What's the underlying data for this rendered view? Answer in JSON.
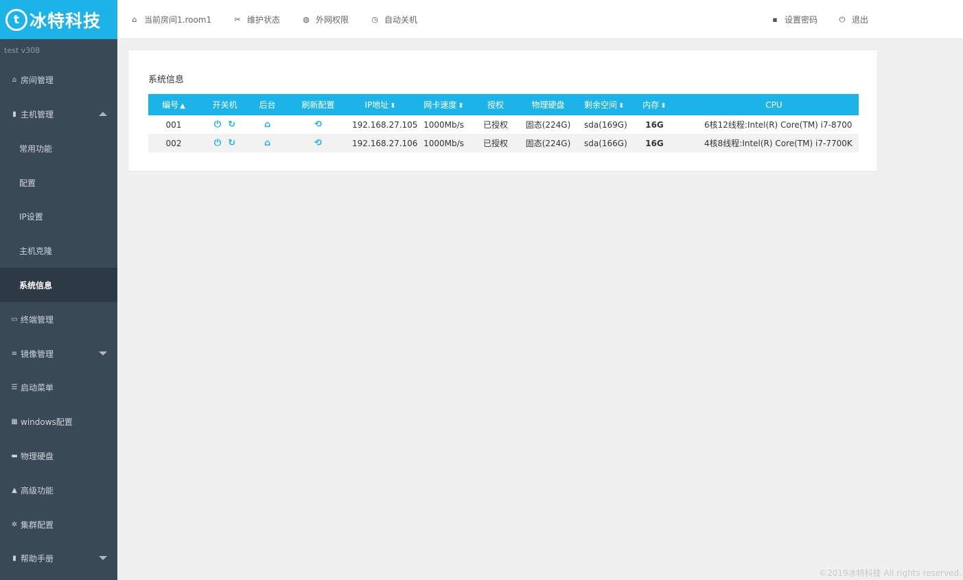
{
  "brand": {
    "badge": "t",
    "name": "冰特科技"
  },
  "topnav": {
    "room": "当前房间1.room1",
    "maintenance": "维护状态",
    "network": "外网权限",
    "auto_shutdown": "自动关机",
    "set_password": "设置密码",
    "logout": "退出"
  },
  "sidebar": {
    "version": "test  v308",
    "items": [
      {
        "label": "房间管理",
        "icon": "home-icon"
      },
      {
        "label": "主机管理",
        "icon": "server-icon"
      },
      {
        "label": "常用功能"
      },
      {
        "label": "配置"
      },
      {
        "label": "IP设置"
      },
      {
        "label": "主机克隆"
      },
      {
        "label": "系统信息"
      },
      {
        "label": "终端管理",
        "icon": "monitor-icon"
      },
      {
        "label": "镜像管理",
        "icon": "database-icon"
      },
      {
        "label": "启动菜单",
        "icon": "list-icon"
      },
      {
        "label": "windows配置",
        "icon": "windows-icon"
      },
      {
        "label": "物理硬盘",
        "icon": "hdd-icon"
      },
      {
        "label": "高级功能",
        "icon": "warning-icon"
      },
      {
        "label": "集群配置",
        "icon": "gear-icon"
      },
      {
        "label": "帮助手册",
        "icon": "book-icon"
      }
    ]
  },
  "panel": {
    "title": "系统信息",
    "columns": {
      "id": "编号",
      "power": "开关机",
      "backend": "后台",
      "refresh": "刷新配置",
      "ip": "IP地址",
      "nic": "网卡速度",
      "license": "授权",
      "disk": "物理硬盘",
      "free": "剩余空间",
      "memory": "内存",
      "cpu": "CPU"
    },
    "rows": [
      {
        "id": "001",
        "ip": "192.168.27.105",
        "nic": "1000Mb/s",
        "license": "已授权",
        "disk": "固态(224G)",
        "free": "sda(169G)",
        "memory": "16G",
        "cpu": "6核12线程:Intel(R) Core(TM) i7-8700"
      },
      {
        "id": "002",
        "ip": "192.168.27.106",
        "nic": "1000Mb/s",
        "license": "已授权",
        "disk": "固态(224G)",
        "free": "sda(166G)",
        "memory": "16G",
        "cpu": "4核8线程:Intel(R) Core(TM) i7-7700K"
      }
    ]
  },
  "footer": "©2019冰特科技 All rights reserved.",
  "colors": {
    "accent": "#1bb3e8",
    "sidebar": "#394a56",
    "sidebar_active": "#2b3a44",
    "memory": "#f2683c"
  }
}
